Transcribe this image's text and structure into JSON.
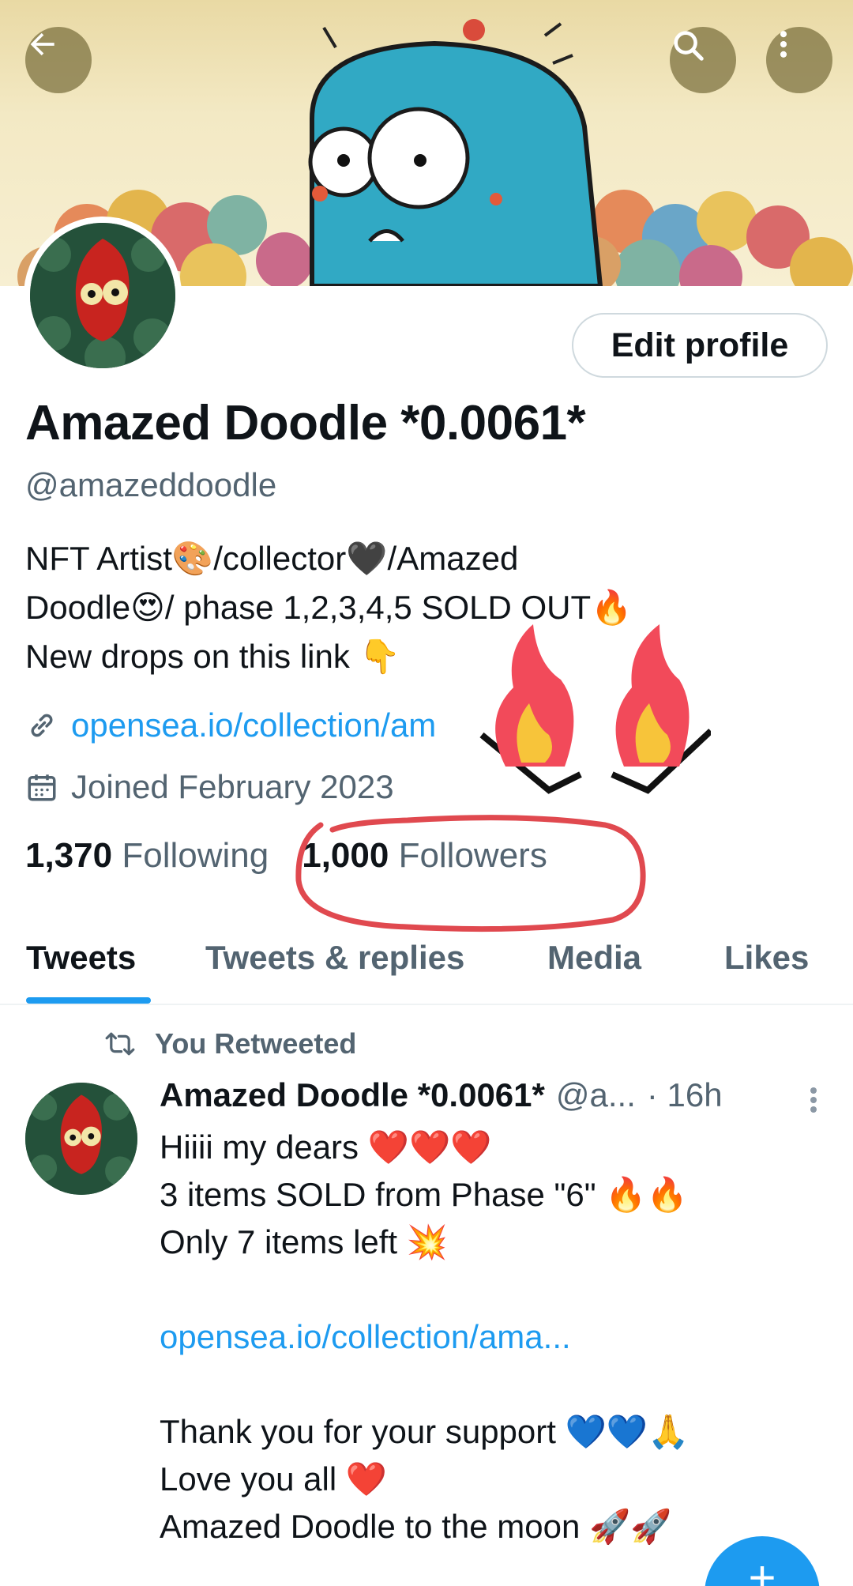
{
  "header": {
    "back_icon": "arrow-left-icon",
    "search_icon": "search-icon",
    "more_icon": "more-vertical-icon"
  },
  "profile": {
    "edit_button_label": "Edit profile",
    "display_name": "Amazed Doodle *0.0061*",
    "handle": "@amazeddoodle",
    "bio_lines": [
      "NFT Artist🎨/collector🖤/Amazed",
      "Doodle😍/ phase 1,2,3,4,5 SOLD OUT🔥",
      "New drops on this link 👇"
    ],
    "link_text": "opensea.io/collection/am",
    "joined_text": "Joined February 2023",
    "following_count": "1,370",
    "following_label": "Following",
    "followers_count": "1,000",
    "followers_label": "Followers"
  },
  "tabs": [
    {
      "label": "Tweets",
      "active": true
    },
    {
      "label": "Tweets & replies",
      "active": false
    },
    {
      "label": "Media",
      "active": false
    },
    {
      "label": "Likes",
      "active": false
    }
  ],
  "tweet": {
    "retweet_label": "You Retweeted",
    "author_name": "Amazed Doodle *0.0061*",
    "author_handle": "@a...",
    "time": "· 16h",
    "lines": [
      "Hiiii my dears ❤️❤️❤️",
      "3 items SOLD from Phase \"6\" 🔥🔥",
      "Only 7 items left 💥",
      "",
      "opensea.io/collection/ama...",
      "",
      "Thank you for your support 💙💙🙏",
      "Love you all ❤️",
      "Amazed Doodle to the moon 🚀🚀"
    ]
  },
  "fab_label": "+",
  "colors": {
    "accent": "#1d9bf0",
    "text_primary": "#0f1419",
    "text_secondary": "#536471",
    "annotation_circle": "#e0494f"
  }
}
